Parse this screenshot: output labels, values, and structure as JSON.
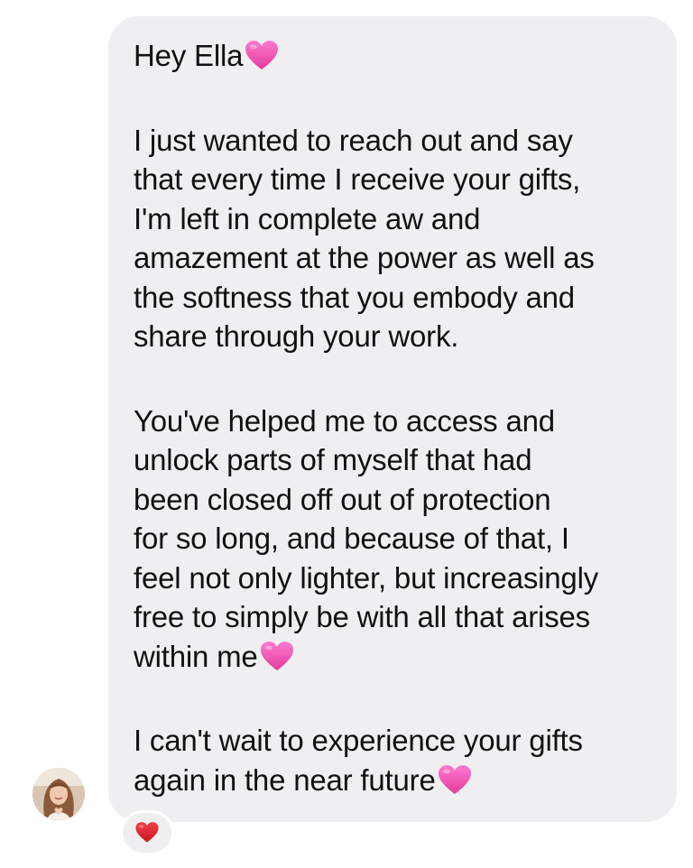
{
  "message": {
    "paragraphs": [
      {
        "lines": [
          {
            "text": "Hey Ella",
            "emoji": "pink-heart-icon"
          }
        ]
      },
      {
        "lines": [
          {
            "text": "I just wanted to reach out and say"
          },
          {
            "text": "that every time I receive your gifts,"
          },
          {
            "text": "I'm left in complete aw and"
          },
          {
            "text": "amazement at the power as well as"
          },
          {
            "text": "the softness that you embody and"
          },
          {
            "text": "share through your work."
          }
        ]
      },
      {
        "lines": [
          {
            "text": "You've helped me to access and"
          },
          {
            "text": "unlock parts of myself that had"
          },
          {
            "text": "been closed off out of protection"
          },
          {
            "text": "for so long, and because of that, I"
          },
          {
            "text": "feel not only lighter, but increasingly"
          },
          {
            "text": "free to simply be with all that arises"
          },
          {
            "text": "within me",
            "emoji": "pink-heart-icon"
          }
        ]
      },
      {
        "lines": [
          {
            "text": "I can't wait to experience your gifts"
          },
          {
            "text": "again in the near future",
            "emoji": "pink-heart-icon"
          }
        ]
      }
    ],
    "reaction": "red-heart-icon"
  },
  "sender": {
    "avatar": "avatar-photo"
  },
  "colors": {
    "bubble": "#efeff1",
    "text": "#111111",
    "pink_heart": "#f14fa8",
    "red_heart": "#e0202e"
  }
}
